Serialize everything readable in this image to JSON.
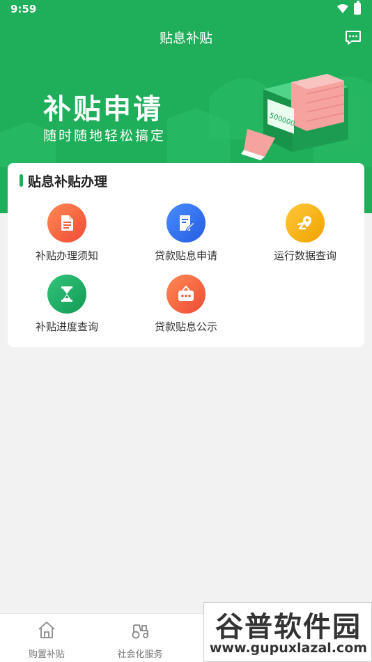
{
  "status_bar": {
    "time": "9:59"
  },
  "header": {
    "title": "贴息补贴"
  },
  "banner": {
    "title": "补贴申请",
    "subtitle": "随时随地轻松搞定",
    "machine_text": "500000"
  },
  "card": {
    "title": "贴息补贴办理",
    "items": [
      {
        "label": "补贴办理须知",
        "icon": "document-icon",
        "color": "#f05a3c"
      },
      {
        "label": "贷款贴息申请",
        "icon": "edit-form-icon",
        "color": "#2f6fe8"
      },
      {
        "label": "运行数据查询",
        "icon": "location-route-icon",
        "color": "#f5b208"
      },
      {
        "label": "补贴进度查询",
        "icon": "hourglass-icon",
        "color": "#1aa160"
      },
      {
        "label": "贷款贴息公示",
        "icon": "notice-board-icon",
        "color": "#f0603c"
      }
    ]
  },
  "bottom_nav": {
    "items": [
      {
        "label": "购置补贴",
        "icon": "home-icon"
      },
      {
        "label": "社会化服务",
        "icon": "tractor-icon"
      }
    ]
  },
  "watermark": {
    "title": "谷普软件园",
    "url": "www.gupuxlazal.com"
  },
  "colors": {
    "primary": "#1fae5a",
    "background": "#f2f2f2"
  }
}
